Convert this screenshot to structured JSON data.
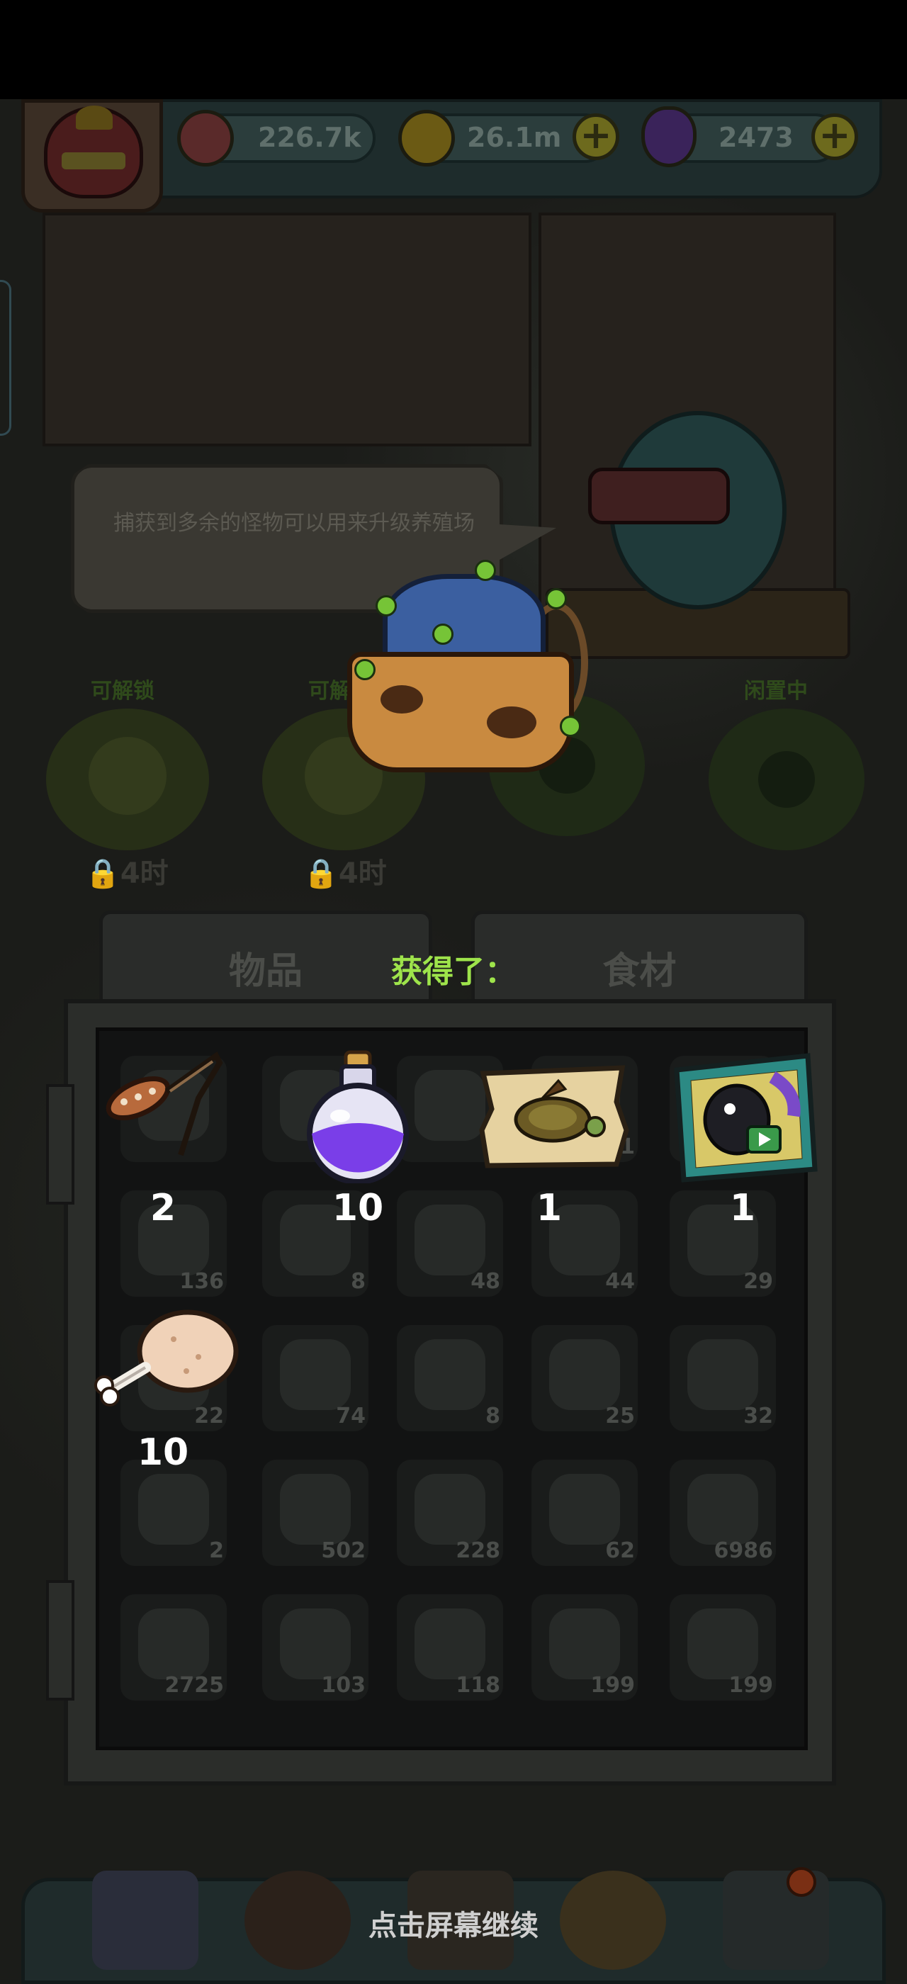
{
  "resources": {
    "eyeballs": "226.7k",
    "coins": "26.1m",
    "potions": "2473"
  },
  "hint": {
    "text": "捕获到多余的怪物可以用来升级养殖场"
  },
  "slots": [
    {
      "label": "可解锁",
      "timer": "4时"
    },
    {
      "label": "可解锁",
      "timer": "4时"
    },
    {
      "label": "闲置中"
    }
  ],
  "inventory": {
    "tabs": [
      "物品",
      "食材"
    ],
    "counts": [
      [
        "",
        "1",
        "",
        "1",
        ""
      ],
      [
        "136",
        "8",
        "48",
        "44",
        "29"
      ],
      [
        "22",
        "74",
        "8",
        "25",
        "32"
      ],
      [
        "2",
        "502",
        "228",
        "62",
        "6986"
      ],
      [
        "2725",
        "103",
        "118",
        "199",
        "199"
      ]
    ]
  },
  "reward": {
    "title": "获得了：",
    "items": [
      {
        "icon": "slingshot-icon",
        "qty": "2"
      },
      {
        "icon": "purple-potion-icon",
        "qty": "10"
      },
      {
        "icon": "turtle-ticket-icon",
        "qty": "1"
      },
      {
        "icon": "video-card-icon",
        "qty": "1"
      },
      {
        "icon": "meat-leg-icon",
        "qty": "10"
      }
    ]
  },
  "continue_text": "点击屏幕继续",
  "colors": {
    "title_green": "#9ee44b",
    "overlay_dim": "#121110"
  }
}
